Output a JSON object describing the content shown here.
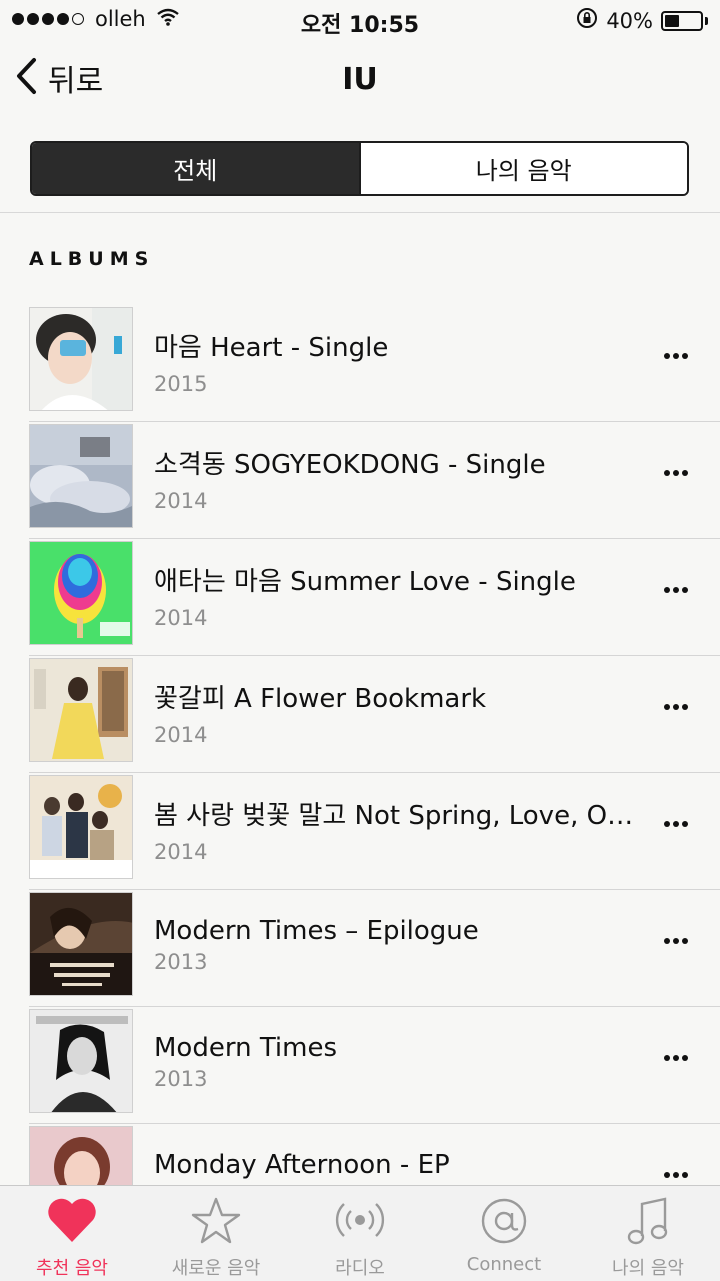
{
  "status_bar": {
    "carrier": "olleh",
    "time": "오전 10:55",
    "battery": "40%",
    "battery_level": 0.4
  },
  "nav": {
    "back_label": "뒤로",
    "title": "IU"
  },
  "segments": [
    "전체",
    "나의 음악"
  ],
  "section_header": "ALBUMS",
  "albums": [
    {
      "title": "마음 Heart - Single",
      "year": "2015"
    },
    {
      "title": "소격동 SOGYEOKDONG - Single",
      "year": "2014"
    },
    {
      "title": "애타는 마음 Summer Love - Single",
      "year": "2014"
    },
    {
      "title": "꽃갈피 A Flower Bookmark",
      "year": "2014"
    },
    {
      "title": "봄 사랑 벚꽃 말고 Not Spring, Love, Or Cherry Blossoms",
      "year": "2014"
    },
    {
      "title": "Modern Times – Epilogue",
      "year": "2013"
    },
    {
      "title": "Modern Times",
      "year": "2013"
    },
    {
      "title": "Monday Afternoon - EP",
      "year": ""
    }
  ],
  "tabs": [
    {
      "label": "추천 음악",
      "icon": "heart-icon"
    },
    {
      "label": "새로운 음악",
      "icon": "star-icon"
    },
    {
      "label": "라디오",
      "icon": "radio-icon"
    },
    {
      "label": "Connect",
      "icon": "at-icon"
    },
    {
      "label": "나의 음악",
      "icon": "music-note-icon"
    }
  ],
  "colors": {
    "accent": "#f0335a",
    "segment_active": "#2b2b2b",
    "inactive_tab": "#9a9a9a"
  }
}
